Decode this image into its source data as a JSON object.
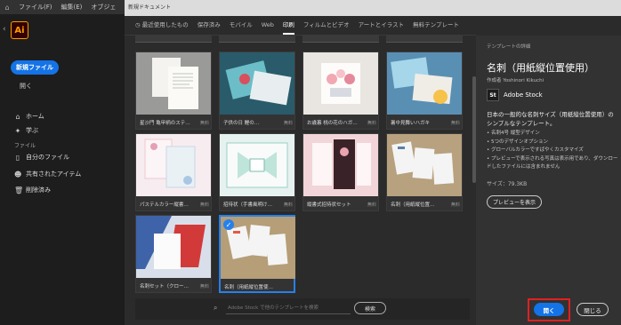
{
  "menubar": {
    "items": [
      "ファイル(F)",
      "編集(E)",
      "オブジェ"
    ]
  },
  "sidebar": {
    "app_logo": "Ai",
    "new_file": "新規ファイル",
    "open": "開く",
    "home": "ホーム",
    "learn": "学ぶ",
    "files_section": "ファイル",
    "my_files": "自分のファイル",
    "shared": "共有されたアイテム",
    "deleted": "削除済み"
  },
  "dialog": {
    "title": "新規ドキュメント",
    "tabs": [
      "最近使用したもの",
      "保存済み",
      "モバイル",
      "Web",
      "印刷",
      "フィルムとビデオ",
      "アートとイラスト",
      "無料テンプレート"
    ],
    "active_tab": "印刷",
    "templates": [
      {
        "name": "星沙門 亀甲柄のステ…",
        "badge": "無料"
      },
      {
        "name": "子供の日 鯉の…",
        "badge": "無料"
      },
      {
        "name": "お歳暮 桃の花のハガ…",
        "badge": "無料"
      },
      {
        "name": "暑中見舞いハガキ",
        "badge": "無料"
      },
      {
        "name": "パステルカラー縦書式…",
        "badge": "無料"
      },
      {
        "name": "招待状（手書風明け…",
        "badge": "無料"
      },
      {
        "name": "縦書式招待状セット",
        "badge": "無料"
      },
      {
        "name": "名刺（用紙縦位置…",
        "badge": "無料"
      },
      {
        "name": "名刺セット（クローバ…",
        "badge": "無料"
      },
      {
        "name": "名刺（用紙縦位置使用）",
        "badge": ""
      }
    ],
    "search_placeholder": "Adobe Stock で他のテンプレートを検索",
    "search_button": "検索",
    "details": {
      "header": "テンプレートの詳細",
      "title": "名刺（用紙縦位置使用）",
      "author": "作成者 Yoshinori Kikuchi",
      "stock_logo": "St",
      "stock": "Adobe Stock",
      "description": "日本の一般的な名刺サイズ（用紙縦位置使用）のシンプルなテンプレート。",
      "bullets": [
        "名刺4号 縦型デザイン",
        "5つのデザインオプション",
        "グローバルカラーですばやくカスタマイズ",
        "プレビューで表示される写真は表示用であり、ダウンロードしたファイルには含まれません"
      ],
      "size": "サイズ：79.3KB",
      "preview_button": "プレビューを表示"
    },
    "open_button": "開く",
    "close_button": "閉じる"
  },
  "colors": {
    "accent": "#1473e6",
    "highlight_frame": "#e02020"
  }
}
